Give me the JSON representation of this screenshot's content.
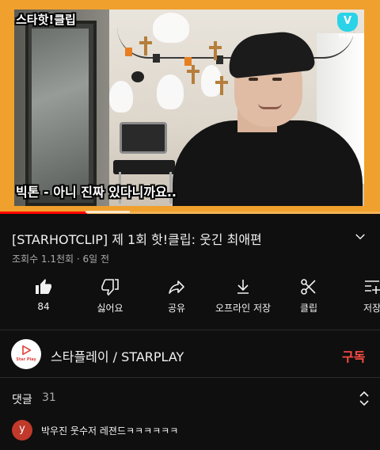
{
  "video": {
    "channel_watermark": "스타핫!클립",
    "vlive_label": "VLIVE",
    "vlive_mark": "V",
    "subtitle": "빅톤 - 아니 진짜 있다니까요..",
    "progress_fraction": 0.23
  },
  "title": "[STARHOTCLIP] 제 1회 핫!클립: 웃긴 최애편",
  "meta": "조회수 1.1천회 · 6일 전",
  "actions": [
    {
      "name": "like",
      "label": "84",
      "icon": "thumb-up-icon"
    },
    {
      "name": "dislike",
      "label": "싫어요",
      "icon": "thumb-down-icon"
    },
    {
      "name": "share",
      "label": "공유",
      "icon": "share-icon"
    },
    {
      "name": "offline-save",
      "label": "오프라인 저장",
      "icon": "download-icon"
    },
    {
      "name": "clip",
      "label": "클립",
      "icon": "scissors-icon"
    },
    {
      "name": "save",
      "label": "저장",
      "icon": "playlist-add-icon"
    }
  ],
  "channel": {
    "name": "스타플레이 / STARPLAY",
    "avatar_text": "Star Play",
    "subscribe_label": "구독"
  },
  "comments": {
    "label": "댓글",
    "count": "31",
    "first": {
      "avatar_letter": "y",
      "text": "박우진 웃수저 레젼드ㅋㅋㅋㅋㅋㅋ"
    }
  },
  "colors": {
    "background": "#0f0f0f",
    "subscribe": "#ff4e45",
    "video_frame": "#f0a02c",
    "avatar": "#c0392b"
  }
}
